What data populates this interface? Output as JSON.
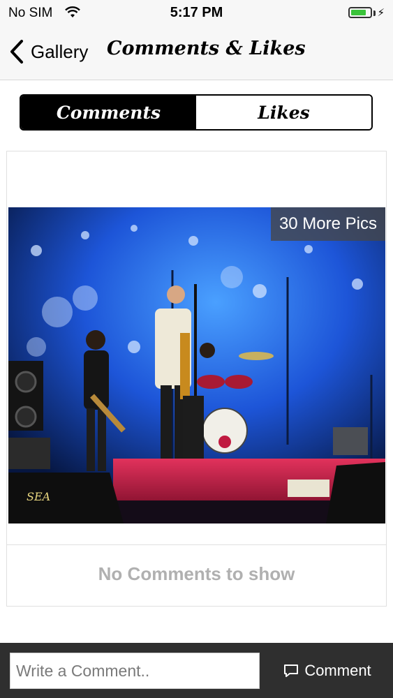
{
  "status_bar": {
    "carrier": "No SIM",
    "time": "5:17 PM",
    "battery_level": 0.8,
    "battery_color": "#3ac33a"
  },
  "nav": {
    "back_label": "Gallery",
    "title": "Comments & Likes"
  },
  "tabs": [
    {
      "label": "Comments",
      "active": true
    },
    {
      "label": "Likes",
      "active": false
    }
  ],
  "post": {
    "more_pics_label": "30 More Pics",
    "photo_subject": "band performing on stage",
    "empty_comments_text": "No Comments to show"
  },
  "composer": {
    "placeholder": "Write a Comment..",
    "button_label": "Comment",
    "button_icon": "speech-bubble-icon"
  }
}
